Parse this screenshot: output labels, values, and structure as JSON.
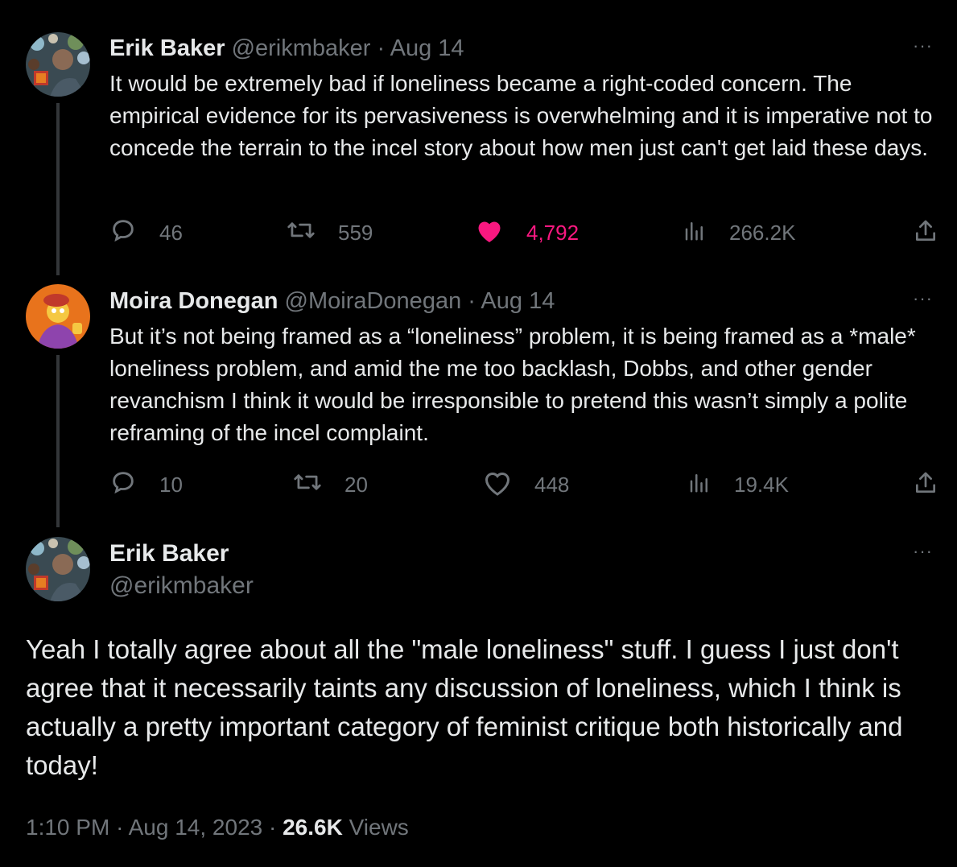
{
  "tweets": [
    {
      "name": "Erik Baker",
      "handle": "@erikmbaker",
      "separator": "·",
      "date": "Aug 14",
      "text": "It would be extremely bad if loneliness became a right-coded concern. The empirical evidence for its pervasiveness is overwhelming and it is imperative not to concede the terrain to the incel story about how men just can't get laid these days.",
      "replies": "46",
      "retweets": "559",
      "likes": "4,792",
      "liked": true,
      "views": "266.2K"
    },
    {
      "name": "Moira Donegan",
      "handle": "@MoiraDonegan",
      "separator": "·",
      "date": "Aug 14",
      "text": "But it’s not being framed as a “loneliness” problem, it is being framed as a *male* loneliness problem, and amid the me too backlash, Dobbs, and other gender revanchism I think it would be irresponsible to pretend this wasn’t simply a polite reframing of the incel complaint.",
      "replies": "10",
      "retweets": "20",
      "likes": "448",
      "liked": false,
      "views": "19.4K"
    }
  ],
  "main_tweet": {
    "name": "Erik Baker",
    "handle": "@erikmbaker",
    "text": "Yeah I totally agree about all the \"male loneliness\" stuff. I guess I just don't agree that it necessarily taints any discussion of loneliness, which I think is actually a pretty important category of feminist critique both historically and today!",
    "time": "1:10 PM",
    "separator": "·",
    "date": "Aug 14, 2023",
    "views_count": "26.6K",
    "views_label": "Views"
  },
  "more_label": "···",
  "colors": {
    "background": "#000000",
    "text_primary": "#e7e9ea",
    "text_secondary": "#71767b",
    "like_active": "#f91880",
    "thread_line": "#333639"
  },
  "icons": [
    "reply-icon",
    "retweet-icon",
    "like-icon",
    "views-icon",
    "share-icon",
    "more-icon"
  ]
}
